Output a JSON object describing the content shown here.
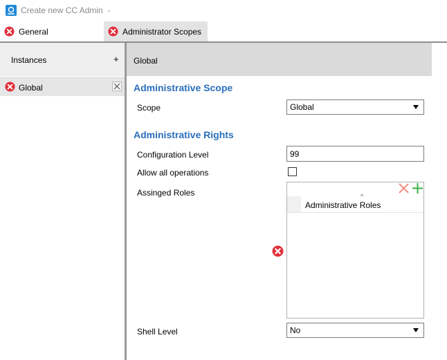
{
  "window": {
    "title": "Create new CC Admin  -"
  },
  "tabs": [
    {
      "label": "General",
      "icon": "error-icon"
    },
    {
      "label": "Administrator Scopes",
      "icon": "error-icon"
    }
  ],
  "instances": {
    "header": "Instances",
    "add_glyph": "+",
    "items": [
      {
        "label": "Global",
        "icon": "error-icon"
      }
    ]
  },
  "detail": {
    "header": "Global",
    "scope_section": "Administrative Scope",
    "scope_label": "Scope",
    "scope_value": "Global",
    "rights_section": "Administrative Rights",
    "config_label": "Configuration Level",
    "config_value": "99",
    "allow_label": "Allow all operations",
    "allow_checked": false,
    "roles_label": "Assinged Roles",
    "roles_column": "Administrative Roles",
    "shell_label": "Shell Level",
    "shell_value": "No"
  },
  "colors": {
    "accent": "#2a6ebb",
    "error": "#e0303b",
    "add": "#3cb043",
    "remove": "#f08070"
  }
}
